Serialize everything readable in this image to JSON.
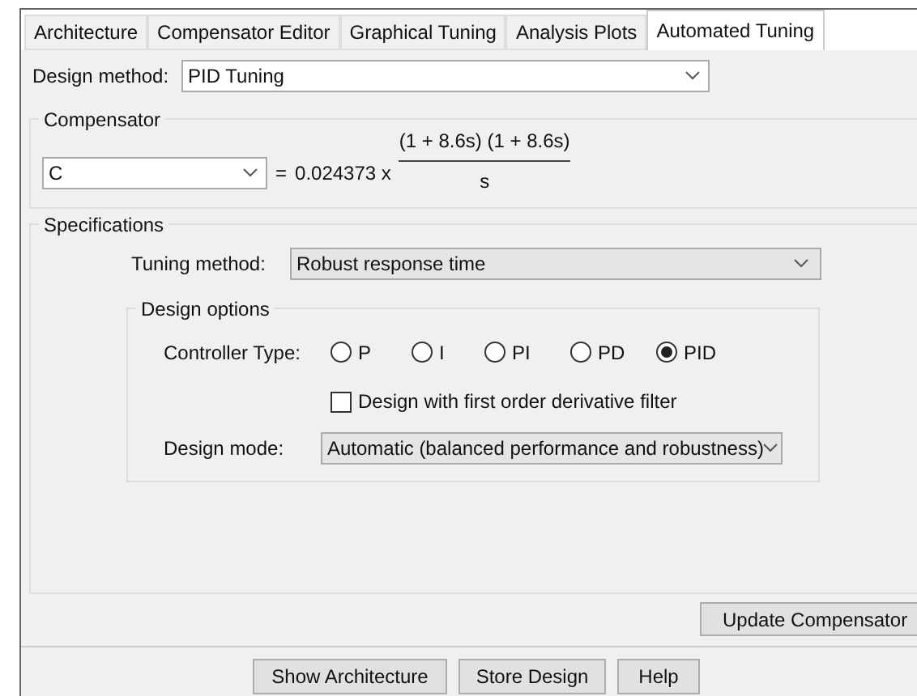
{
  "tabs": [
    {
      "label": "Architecture",
      "selected": false
    },
    {
      "label": "Compensator Editor",
      "selected": false
    },
    {
      "label": "Graphical Tuning",
      "selected": false
    },
    {
      "label": "Analysis Plots",
      "selected": false
    },
    {
      "label": "Automated Tuning",
      "selected": true
    }
  ],
  "design_method": {
    "label": "Design method:",
    "value": "PID Tuning"
  },
  "compensator": {
    "title": "Compensator",
    "select_value": "C",
    "equals": "=",
    "gain": "0.024373 x",
    "numerator": "(1 + 8.6s) (1 + 8.6s)",
    "denominator": "s"
  },
  "specifications": {
    "title": "Specifications",
    "tuning_method": {
      "label": "Tuning method:",
      "value": "Robust response time"
    },
    "design_options": {
      "title": "Design options",
      "controller_type": {
        "label": "Controller Type:",
        "options": [
          {
            "label": "P",
            "selected": false
          },
          {
            "label": "I",
            "selected": false
          },
          {
            "label": "PI",
            "selected": false
          },
          {
            "label": "PD",
            "selected": false
          },
          {
            "label": "PID",
            "selected": true
          }
        ]
      },
      "derivative_filter": {
        "label": "Design with first order derivative filter",
        "checked": false
      },
      "design_mode": {
        "label": "Design mode:",
        "value": "Automatic (balanced performance and robustness)"
      }
    }
  },
  "update_button": "Update Compensator",
  "bottom_buttons": [
    "Show Architecture",
    "Store Design",
    "Help"
  ]
}
